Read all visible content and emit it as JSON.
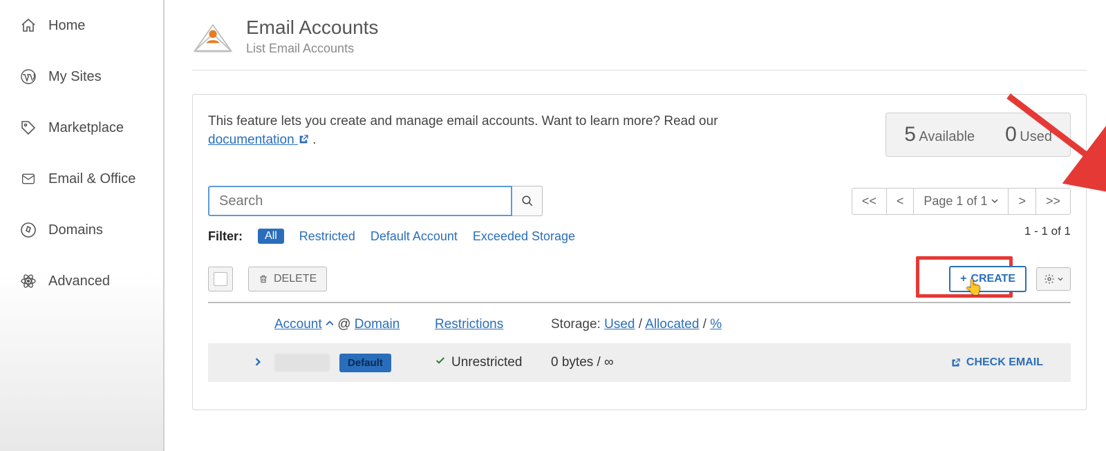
{
  "sidebar": {
    "items": [
      {
        "label": "Home"
      },
      {
        "label": "My Sites"
      },
      {
        "label": "Marketplace"
      },
      {
        "label": "Email & Office"
      },
      {
        "label": "Domains"
      },
      {
        "label": "Advanced"
      }
    ]
  },
  "header": {
    "title": "Email Accounts",
    "subtitle": "List Email Accounts"
  },
  "intro": {
    "text_before_link": "This feature lets you create and manage email accounts. Want to learn more? Read our ",
    "link_text": "documentation",
    "text_after_link": " ."
  },
  "counts": {
    "available_num": "5",
    "available_label": "Available",
    "used_num": "0",
    "used_label": "Used"
  },
  "search": {
    "placeholder": "Search"
  },
  "pager": {
    "first": "<<",
    "prev": "<",
    "page_label": "Page 1 of 1",
    "next": ">",
    "last": ">>"
  },
  "filter": {
    "label": "Filter:",
    "all": "All",
    "restricted": "Restricted",
    "default_account": "Default Account",
    "exceeded": "Exceeded Storage"
  },
  "range_text": "1 - 1 of 1",
  "actions": {
    "delete": "DELETE",
    "create": "CREATE"
  },
  "columns": {
    "account": "Account",
    "at": "@",
    "domain": "Domain",
    "restrictions": "Restrictions",
    "storage_prefix": "Storage:",
    "used": "Used",
    "allocated": "Allocated",
    "pct": "%"
  },
  "row": {
    "badge": "Default",
    "restriction": "Unrestricted",
    "storage": "0 bytes / ∞",
    "check_email": "CHECK EMAIL"
  }
}
